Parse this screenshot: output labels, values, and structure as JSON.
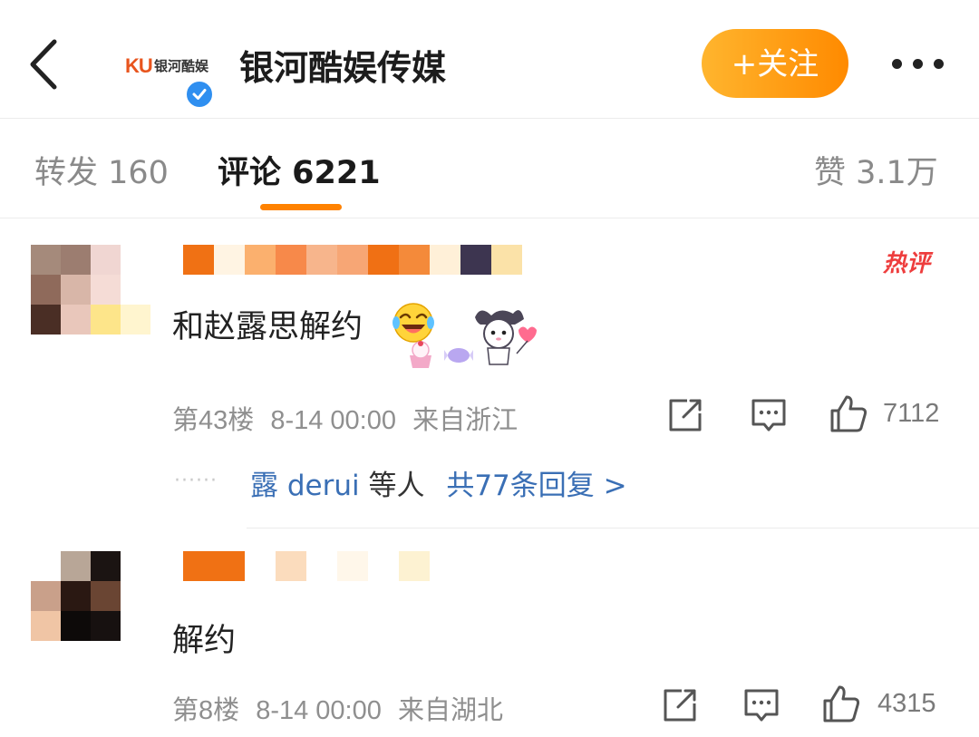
{
  "header": {
    "back_icon": "chevron-left-icon",
    "account_logo_ku": "KU",
    "account_logo_text": "银河酷娱",
    "verified_icon": "verified-check-icon",
    "title": "银河酷娱传媒",
    "follow_label": "+关注",
    "more_icon": "more-horizontal-icon",
    "accent_color": "#ff8a00"
  },
  "tabs": [
    {
      "label": "转发 160",
      "active": false
    },
    {
      "label": "评论 6221",
      "active": true
    },
    {
      "label": "赞 3.1万",
      "active": false
    }
  ],
  "comments": [
    {
      "badge": "热评",
      "text": "和赵露思解约",
      "floor": "第43楼",
      "time": "8-14 00:00",
      "location": "来自浙江",
      "likes": "7112",
      "share_icon": "share-icon",
      "comment_icon": "comment-icon",
      "like_icon": "thumbs-up-icon",
      "replies": {
        "dots": "······",
        "user": "露 derui",
        "mid": "等人",
        "total": "共77条回复 >"
      }
    },
    {
      "text": "解约",
      "floor": "第8楼",
      "time": "8-14 00:00",
      "location": "来自湖北",
      "likes": "4315",
      "share_icon": "share-icon",
      "comment_icon": "comment-icon",
      "like_icon": "thumbs-up-icon"
    }
  ]
}
